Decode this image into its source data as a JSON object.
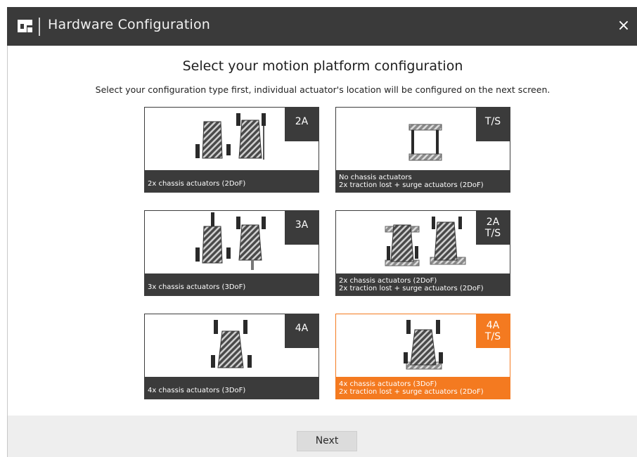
{
  "window": {
    "title": "Hardware Configuration",
    "close_label": "×"
  },
  "main": {
    "heading": "Select your motion platform configuration",
    "subheading": "Select your configuration type first, individual actuator's location will be configured on the next screen."
  },
  "options": [
    {
      "badge": [
        "2A"
      ],
      "caption": [
        "2x chassis actuators (2DoF)"
      ],
      "selected": false
    },
    {
      "badge": [
        "T/S"
      ],
      "caption": [
        "No chassis actuators",
        "2x traction lost + surge actuators (2DoF)"
      ],
      "selected": false
    },
    {
      "badge": [
        "3A"
      ],
      "caption": [
        "3x chassis actuators (3DoF)"
      ],
      "selected": false
    },
    {
      "badge": [
        "2A",
        "T/S"
      ],
      "caption": [
        "2x chassis actuators (2DoF)",
        "2x traction lost + surge actuators (2DoF)"
      ],
      "selected": false
    },
    {
      "badge": [
        "4A"
      ],
      "caption": [
        "4x chassis actuators (3DoF)"
      ],
      "selected": false
    },
    {
      "badge": [
        "4A",
        "T/S"
      ],
      "caption": [
        "4x chassis actuators (3DoF)",
        "2x traction lost + surge actuators (2DoF)"
      ],
      "selected": true
    }
  ],
  "footer": {
    "next_label": "Next"
  },
  "colors": {
    "titlebar": "#3a3a3a",
    "dark": "#3b3b3b",
    "accent": "#f47a20"
  }
}
